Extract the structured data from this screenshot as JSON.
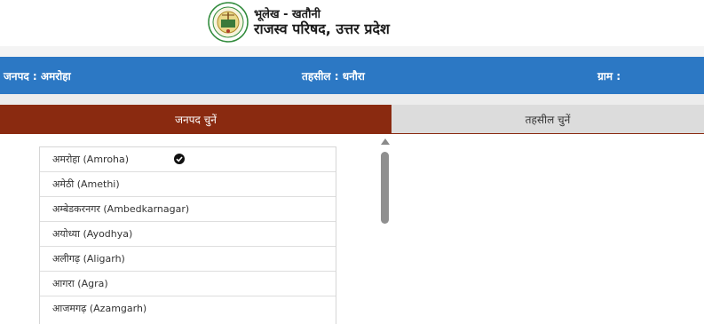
{
  "header": {
    "title_line1": "भूलेख - खतौनी",
    "title_line2": "राजस्व परिषद, उत्तर प्रदेश",
    "logo_icon": "emblem-seal-icon"
  },
  "location_bar": {
    "district_label": "जनपद : अमरोहा",
    "tehsil_label": "तहसील : धनौरा",
    "village_label": "ग्राम :",
    "color": "#2c78c4"
  },
  "tabs": {
    "district_tab_label": "जनपद चुनें",
    "tehsil_tab_label": "तहसील चुनें",
    "active_color": "#8a2a10"
  },
  "district_list": {
    "selected": "अमरोहा (Amroha)",
    "selected_icon": "check-circle-icon",
    "items": [
      "अमरोहा (Amroha)",
      "अमेठी (Amethi)",
      "अम्बेडकरनगर (Ambedkarnagar)",
      "अयोध्या (Ayodhya)",
      "अलीगढ़ (Aligarh)",
      "आगरा (Agra)",
      "आजमगढ़ (Azamgarh)"
    ]
  },
  "scrollbar": {
    "up_icon": "scroll-up-arrow-icon"
  }
}
